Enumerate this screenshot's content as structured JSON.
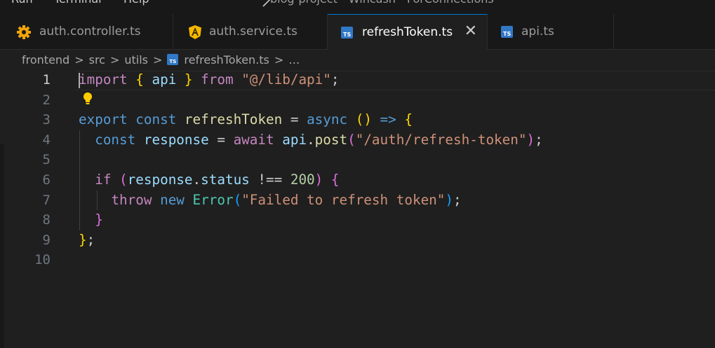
{
  "menu": {
    "items": [
      "Run",
      "Terminal",
      "Help"
    ],
    "window_title": "blog-project - Wincash - ForConnections"
  },
  "tabs": [
    {
      "label": "auth.controller.ts",
      "icon": "gear-icon",
      "active": false
    },
    {
      "label": "auth.service.ts",
      "icon": "angular-icon",
      "active": false
    },
    {
      "label": "refreshToken.ts",
      "icon": "ts-file-icon",
      "active": true
    },
    {
      "label": "api.ts",
      "icon": "ts-file-icon",
      "active": false
    }
  ],
  "ts_badge": "TS",
  "close_glyph": "✕",
  "breadcrumb": {
    "parts": [
      "frontend",
      "src",
      "utils",
      "refreshToken.ts",
      "…"
    ],
    "separator": ">"
  },
  "line_numbers": [
    "1",
    "2",
    "3",
    "4",
    "5",
    "6",
    "7",
    "8",
    "9",
    "10"
  ],
  "active_line": 1,
  "code": {
    "l1": {
      "t1": "import",
      "t2": " ",
      "t3": "{",
      "t4": " ",
      "t5": "api",
      "t6": " ",
      "t7": "}",
      "t8": " ",
      "t9": "from",
      "t10": " ",
      "t11": "\"@/lib/api\"",
      "t12": ";"
    },
    "l3": {
      "t1": "export",
      "t2": " ",
      "t3": "const",
      "t4": " ",
      "t5": "refreshToken",
      "t6": " = ",
      "t7": "async",
      "t8": " ",
      "t9": "()",
      "t10": " ",
      "t11": "=>",
      "t12": " ",
      "t13": "{"
    },
    "l4": {
      "t1": "  ",
      "t2": "const",
      "t3": " ",
      "t4": "response",
      "t5": " = ",
      "t6": "await",
      "t7": " ",
      "t8": "api",
      "t9": ".",
      "t10": "post",
      "t11": "(",
      "t12": "\"/auth/refresh-token\"",
      "t13": ")",
      "t14": ";"
    },
    "l6": {
      "t1": "  ",
      "t2": "if",
      "t3": " ",
      "t4": "(",
      "t5": "response",
      "t6": ".",
      "t7": "status",
      "t8": " !== ",
      "t9": "200",
      "t10": ")",
      "t11": " ",
      "t12": "{"
    },
    "l7": {
      "t1": "    ",
      "t2": "throw",
      "t3": " ",
      "t4": "new",
      "t5": " ",
      "t6": "Error",
      "t7": "(",
      "t8": "\"Failed to refresh token\"",
      "t9": ")",
      "t10": ";"
    },
    "l8": {
      "t1": "  ",
      "t2": "}"
    },
    "l9": {
      "t1": "}",
      "t2": ";"
    }
  },
  "colors": {
    "editor_bg": "#1f1f1f",
    "tab_active_border": "#0078d4",
    "keyword": "#569cd6",
    "control": "#c586c0",
    "variable": "#9cdcfe",
    "function": "#dcdcaa",
    "string": "#ce9178",
    "number": "#b5cea8",
    "class": "#4ec9b0",
    "bracket_1": "#ffd700",
    "bracket_2": "#da70d6",
    "bracket_3": "#179fff",
    "lightbulb": "#ffcc00"
  }
}
